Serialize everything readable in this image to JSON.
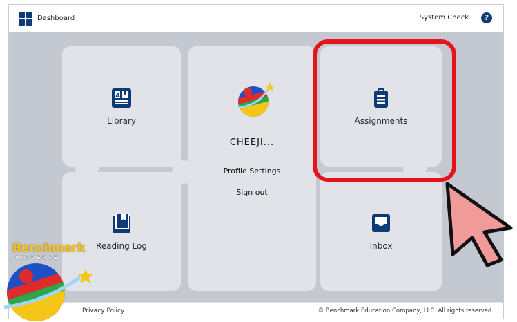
{
  "topbar": {
    "dashboard_label": "Dashboard",
    "system_check_label": "System Check",
    "help_label": "?"
  },
  "tiles": {
    "library": {
      "label": "Library",
      "icon": "book-icon"
    },
    "reading_log": {
      "label": "Reading Log",
      "icon": "bookmark-book-icon"
    },
    "assignments": {
      "label": "Assignments",
      "icon": "clipboard-icon"
    },
    "inbox": {
      "label": "Inbox",
      "icon": "inbox-tray-icon"
    }
  },
  "profile": {
    "user_name": "CHEEJI...",
    "profile_settings_label": "Profile Settings",
    "sign_out_label": "Sign out"
  },
  "footer": {
    "privacy_label": "Privacy Policy",
    "copyright": "© Benchmark Education Company, LLC. All rights reserved."
  },
  "logo": {
    "word": "Benchmark",
    "sub": "UNIVERSE"
  },
  "colors": {
    "brand_navy": "#0f3a78",
    "highlight_red": "#e5141b",
    "tile_bg": "#e1e3e8",
    "content_bg": "#c4c8d1"
  }
}
